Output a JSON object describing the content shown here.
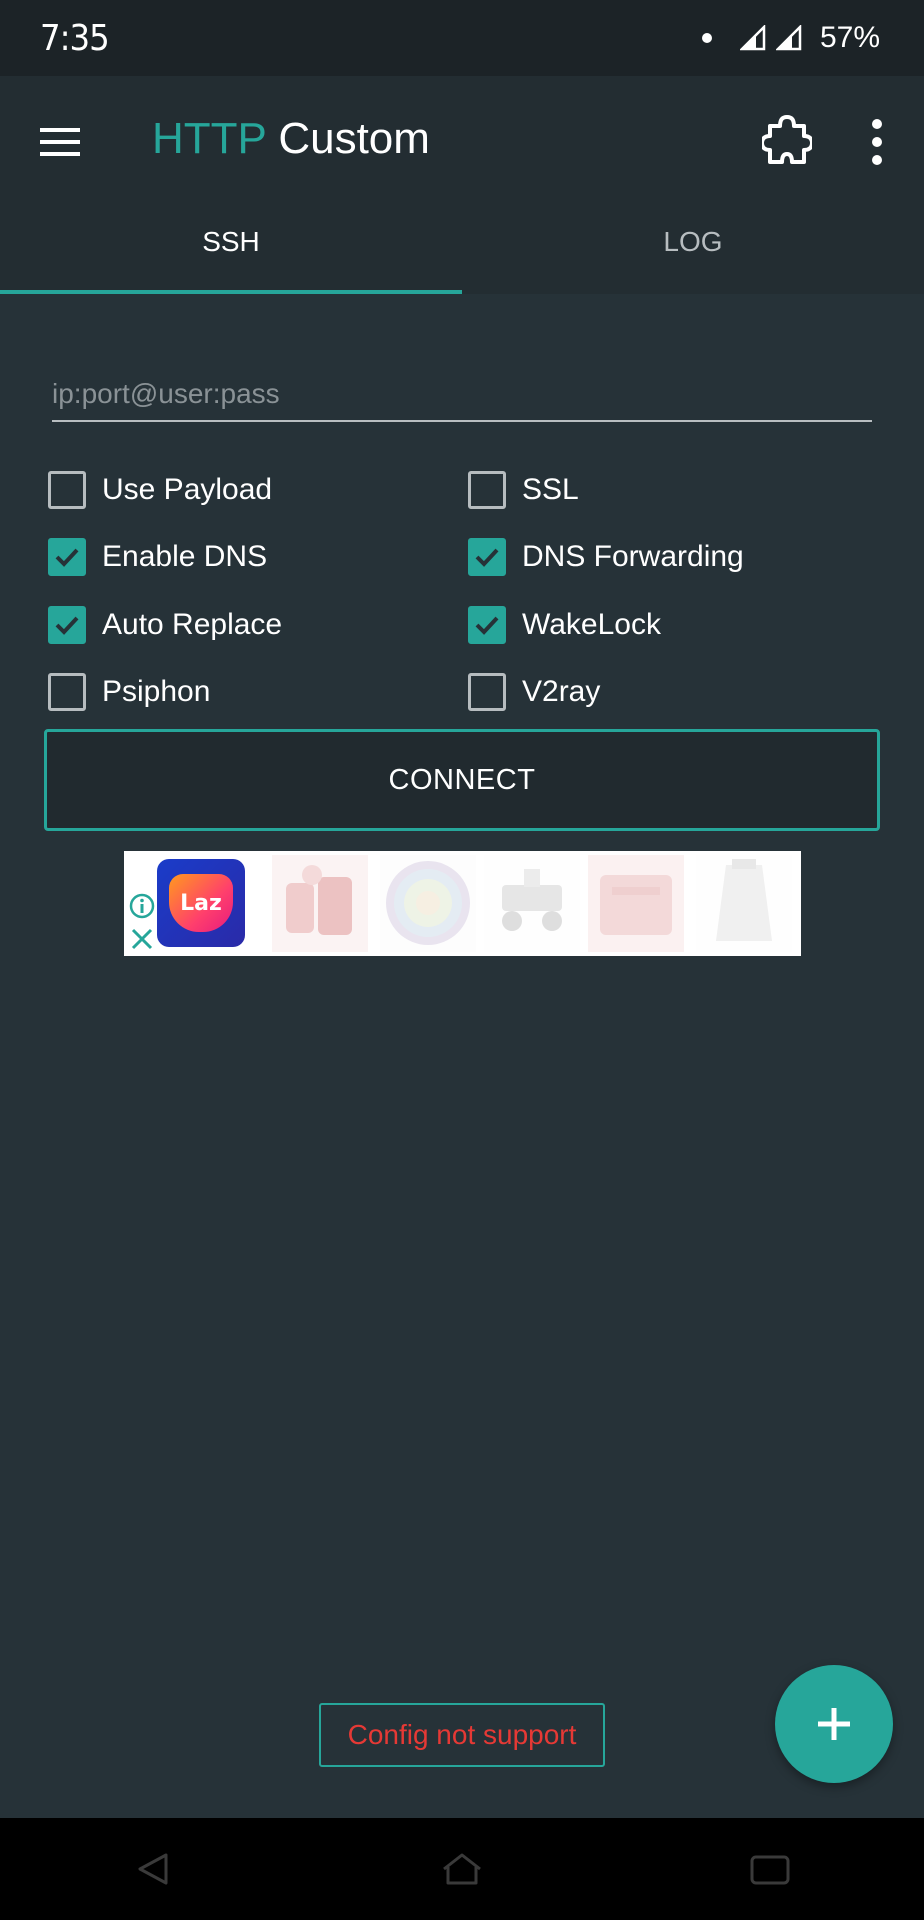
{
  "status_bar": {
    "time": "7:35",
    "battery": "57%"
  },
  "app_bar": {
    "title_accent": "HTTP",
    "title_rest": " Custom"
  },
  "tabs": [
    {
      "label": "SSH",
      "active": true
    },
    {
      "label": "LOG",
      "active": false
    }
  ],
  "ssh": {
    "input": {
      "value": "",
      "placeholder": "ip:port@user:pass"
    },
    "options": [
      {
        "label": "Use Payload",
        "checked": false
      },
      {
        "label": "SSL",
        "checked": false
      },
      {
        "label": "Enable DNS",
        "checked": true
      },
      {
        "label": "DNS Forwarding",
        "checked": true
      },
      {
        "label": "Auto Replace",
        "checked": true
      },
      {
        "label": "WakeLock",
        "checked": true
      },
      {
        "label": "Psiphon",
        "checked": false
      },
      {
        "label": "V2ray",
        "checked": false
      }
    ],
    "connect_label": "CONNECT"
  },
  "ad": {
    "logo_text": "Laz"
  },
  "toast": {
    "message": "Config not support"
  },
  "colors": {
    "accent": "#26a69a",
    "background": "#263238",
    "toolbar": "#232d32",
    "error": "#e53935"
  },
  "icons": [
    "menu-icon",
    "puzzle-icon",
    "more-vert-icon",
    "check-icon",
    "info-icon",
    "close-icon",
    "plus-icon",
    "back-icon",
    "home-icon",
    "recents-icon",
    "signal-icon"
  ]
}
